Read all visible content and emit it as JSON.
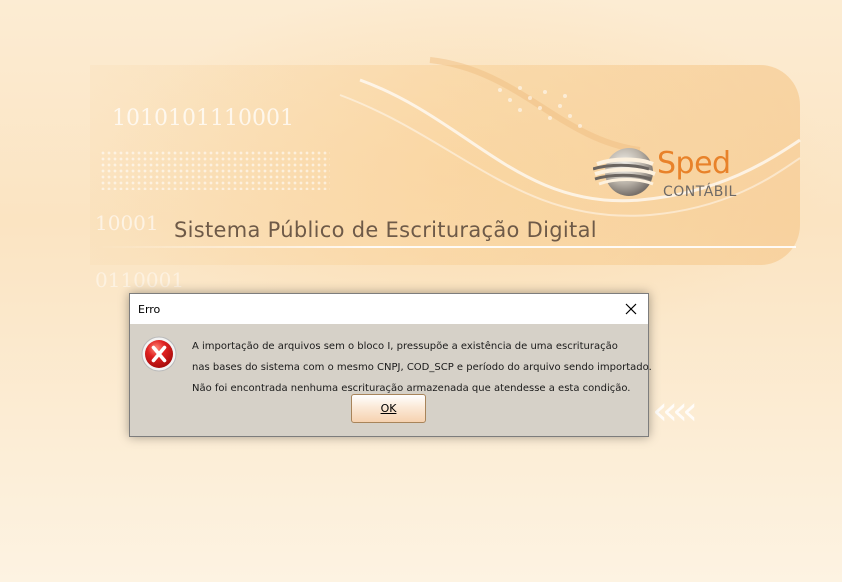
{
  "splash": {
    "binary_row_1": "1010101110001",
    "binary_row_2": "10001",
    "binary_row_3": "0110001",
    "system_title": "Sistema Público de Escrituração Digital",
    "logo_brand": "Sped",
    "logo_product": "CONTÁBIL",
    "decoration_chevrons": "‹‹‹‹",
    "colors": {
      "background": "#fdf1de",
      "logo_orange": "#e8822a",
      "title_text": "#6e5a48"
    }
  },
  "dialog": {
    "title": "Erro",
    "close_icon": "close-icon",
    "error_icon": "error-x-icon",
    "message_lines": [
      "A importação de arquivos sem o bloco I, pressupõe a existência de uma escrituração",
      "nas bases do sistema com o mesmo CNPJ, COD_SCP e período do arquivo sendo importado.",
      "Não foi encontrada nenhuma escrituração armazenada que atendesse a esta condição."
    ],
    "ok_label": "OK",
    "colors": {
      "body_background": "#d6d1c8",
      "error_red": "#d51d1d"
    }
  }
}
